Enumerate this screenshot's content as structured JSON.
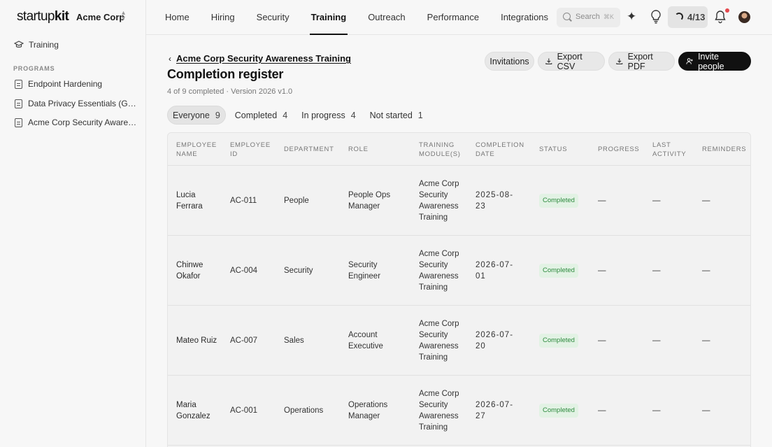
{
  "brand": {
    "logo_light": "startup",
    "logo_bold": "kit",
    "org_name": "Acme Corp"
  },
  "nav": {
    "items": [
      {
        "label": "Home"
      },
      {
        "label": "Hiring"
      },
      {
        "label": "Security"
      },
      {
        "label": "Training",
        "active": true
      },
      {
        "label": "Outreach"
      },
      {
        "label": "Performance"
      },
      {
        "label": "Integrations"
      }
    ]
  },
  "header_tools": {
    "search_placeholder": "Search",
    "search_shortcut": "⌘K",
    "progress_text": "4/13"
  },
  "sidebar": {
    "top_item": "Training",
    "section_title": "PROGRAMS",
    "items": [
      {
        "label": "Endpoint Hardening"
      },
      {
        "label": "Data Privacy Essentials (GDPR)"
      },
      {
        "label": "Acme Corp Security Awareness Training"
      }
    ]
  },
  "page": {
    "back_link": "Acme Corp Security Awareness Training",
    "title": "Completion register",
    "subtitle": "4 of 9 completed · Version 2026 v1.0",
    "buttons": {
      "invitations": "Invitations",
      "export_csv": "Export CSV",
      "export_pdf": "Export PDF",
      "invite_people": "Invite people"
    }
  },
  "tabs": [
    {
      "label": "Everyone",
      "count": "9",
      "active": true
    },
    {
      "label": "Completed",
      "count": "4"
    },
    {
      "label": "In progress",
      "count": "4"
    },
    {
      "label": "Not started",
      "count": "1"
    }
  ],
  "table": {
    "headers": {
      "employee_name": "EMPLOYEE NAME",
      "employee_id": "EMPLOYEE ID",
      "department": "DEPARTMENT",
      "role": "ROLE",
      "training_modules": "TRAINING MODULE(S)",
      "completion_date": "COMPLETION DATE",
      "status": "STATUS",
      "progress": "PROGRESS",
      "last_activity": "LAST ACTIVITY",
      "reminders": "REMINDERS"
    },
    "rows": [
      {
        "name": "Lucia Ferrara",
        "id": "AC-011",
        "department": "People",
        "role": "People Ops Manager",
        "module": "Acme Corp Security Awareness Training",
        "date": "2025-08-23",
        "status": "Completed",
        "progress": "—",
        "last_activity": "—",
        "reminders": "—"
      },
      {
        "name": "Chinwe Okafor",
        "id": "AC-004",
        "department": "Security",
        "role": "Security Engineer",
        "module": "Acme Corp Security Awareness Training",
        "date": "2026-07-01",
        "status": "Completed",
        "progress": "—",
        "last_activity": "—",
        "reminders": "—"
      },
      {
        "name": "Mateo Ruiz",
        "id": "AC-007",
        "department": "Sales",
        "role": "Account Executive",
        "module": "Acme Corp Security Awareness Training",
        "date": "2026-07-20",
        "status": "Completed",
        "progress": "—",
        "last_activity": "—",
        "reminders": "—"
      },
      {
        "name": "Maria Gonzalez",
        "id": "AC-001",
        "department": "Operations",
        "role": "Operations Manager",
        "module": "Acme Corp Security Awareness Training",
        "date": "2026-07-27",
        "status": "Completed",
        "progress": "—",
        "last_activity": "—",
        "reminders": "—"
      }
    ]
  },
  "colors": {
    "accent": "#111111",
    "status_completed_bg": "#e2f2e4",
    "status_completed_text": "#2d8a3e",
    "notification_dot": "#e5484d"
  }
}
